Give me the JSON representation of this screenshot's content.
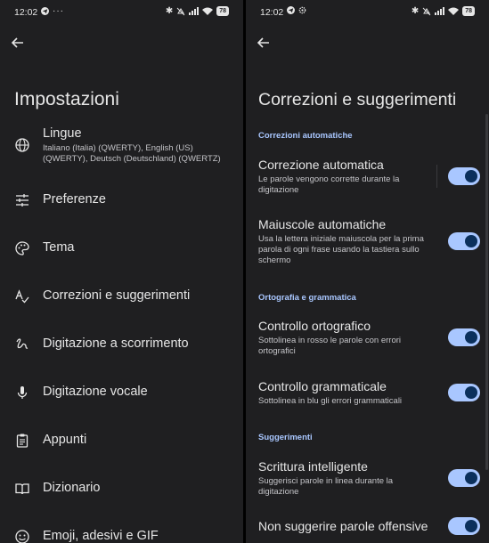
{
  "status": {
    "time": "12:02",
    "battery": "78"
  },
  "left": {
    "title": "Impostazioni",
    "items": [
      {
        "label": "Lingue",
        "sub": "Italiano (Italia) (QWERTY), English (US) (QWERTY), Deutsch (Deutschland) (QWERTZ)",
        "icon": "globe-icon"
      },
      {
        "label": "Preferenze",
        "icon": "sliders-icon"
      },
      {
        "label": "Tema",
        "icon": "palette-icon"
      },
      {
        "label": "Correzioni e suggerimenti",
        "icon": "spellcheck-icon"
      },
      {
        "label": "Digitazione a scorrimento",
        "icon": "gesture-icon"
      },
      {
        "label": "Digitazione vocale",
        "icon": "mic-icon"
      },
      {
        "label": "Appunti",
        "icon": "clipboard-icon"
      },
      {
        "label": "Dizionario",
        "icon": "book-icon"
      },
      {
        "label": "Emoji, adesivi e GIF",
        "icon": "emoji-icon"
      }
    ]
  },
  "right": {
    "title": "Correzioni e suggerimenti",
    "sections": {
      "s1": "Correzioni automatiche",
      "s2": "Ortografia e grammatica",
      "s3": "Suggerimenti"
    },
    "prefs": {
      "p1": {
        "title": "Correzione automatica",
        "sub": "Le parole vengono corrette durante la digitazione",
        "on": true
      },
      "p2": {
        "title": "Maiuscole automatiche",
        "sub": "Usa la lettera iniziale maiuscola per la prima parola di ogni frase usando la tastiera sullo schermo",
        "on": true
      },
      "p3": {
        "title": "Controllo ortografico",
        "sub": "Sottolinea in rosso le parole con errori ortografici",
        "on": true
      },
      "p4": {
        "title": "Controllo grammaticale",
        "sub": "Sottolinea in blu gli errori grammaticali",
        "on": true
      },
      "p5": {
        "title": "Scrittura intelligente",
        "sub": "Suggerisci parole in linea durante la digitazione",
        "on": true
      },
      "p6": {
        "title": "Non suggerire parole offensive",
        "on": true
      }
    }
  },
  "colors": {
    "background": "#1f1f21",
    "accent": "#a9c7ff",
    "toggle_knob": "#0b305c"
  }
}
